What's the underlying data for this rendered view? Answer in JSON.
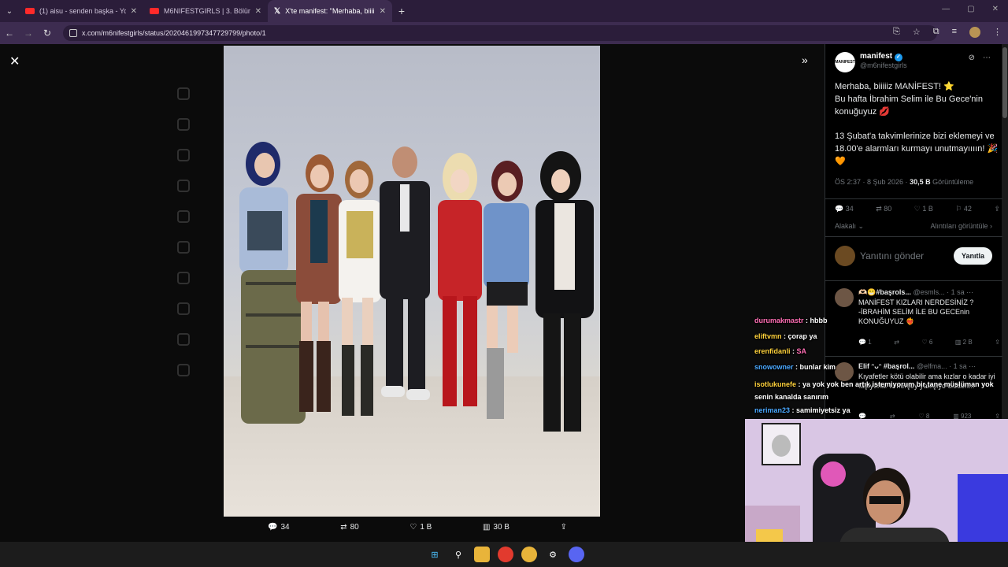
{
  "browser": {
    "tabs": [
      {
        "title": "(1) aisu - senden başka - YouTu",
        "type": "youtube",
        "active": false
      },
      {
        "title": "M6NIFESTGIRLS | 3. Bölüm - Yo",
        "type": "youtube",
        "active": false
      },
      {
        "title": "X'te manifest: \"Merhaba, biiiiiz",
        "type": "x",
        "active": true
      }
    ],
    "url": "x.com/m6nifestgirls/status/2020461997347729799/photo/1"
  },
  "tweet": {
    "author_name": "manifest",
    "author_handle": "@m6nifestgirls",
    "avatar_text": "MANIFEST",
    "paragraphs": [
      "Merhaba, biiiiiz MANİFEST! ⭐",
      "Bu hafta İbrahim Selim ile Bu Gece'nin konuğuyuz 💋",
      "13 Şubat'a takvimlerinize bizi eklemeyi ve 18.00'e alarmları kurmayı unutmayıııın! 🎉🧡"
    ],
    "time": "ÖS 2:37 · 8 Şub 2026 ·",
    "views_count": "30,5 B",
    "views_label": "Görüntüleme",
    "actions": {
      "replies": "34",
      "reposts": "80",
      "likes": "1 B",
      "bookmarks": "42"
    },
    "related_link": "Alakalı",
    "quotes_link": "Alıntıları görüntüle",
    "reply_placeholder": "Yanıtını gönder",
    "reply_button": "Yanıtla"
  },
  "photo_actions": {
    "replies": "34",
    "reposts": "80",
    "likes": "1 B",
    "views": "30 B"
  },
  "replies": [
    {
      "name": "🫶🏻😁#başrols...",
      "handle": "@esmls...",
      "time": "· 1 sa",
      "text": "MANİFEST KIZLARI NERDESİNİZ ? -İBRAHİM SELİM İLE BU GECEnin KONUĞUYUZ ❤️‍🔥",
      "replies": "1",
      "likes": "6",
      "views": "2 B"
    },
    {
      "name": "Elif ᵔᴗᵔ #başrol...",
      "handle": "@elfma...",
      "time": "· 1 sa",
      "text": "Kıyafetler kötü olabilir ama kızlar o kadar iyi taşıyorlar ki herşey yakışıyo cidden...",
      "replies": "",
      "likes": "8",
      "views": "923"
    }
  ],
  "chat": [
    {
      "user": "durumakmastr",
      "color": "#ff6eb4",
      "msg": "hbbb"
    },
    {
      "user": "eliftvmn",
      "color": "#ffd23c",
      "msg": "çorap ya"
    },
    {
      "user": "erenfidanli",
      "color": "#ffd23c",
      "msg": "SA"
    },
    {
      "user": "snowowner",
      "color": "#4aa8ff",
      "msg": "bunlar kim"
    },
    {
      "user": "isotlukunefe",
      "color": "#ffd23c",
      "msg": "ya yok yok ben artık istemiyorum bir tane müslüman yok senin kanalda sanırım"
    },
    {
      "user": "neriman23",
      "color": "#4aa8ff",
      "msg": "samimiyetsiz ya"
    }
  ],
  "colors": {
    "accent": "#1d9bf0",
    "chrome": "#3d2c50",
    "background": "#000000"
  }
}
